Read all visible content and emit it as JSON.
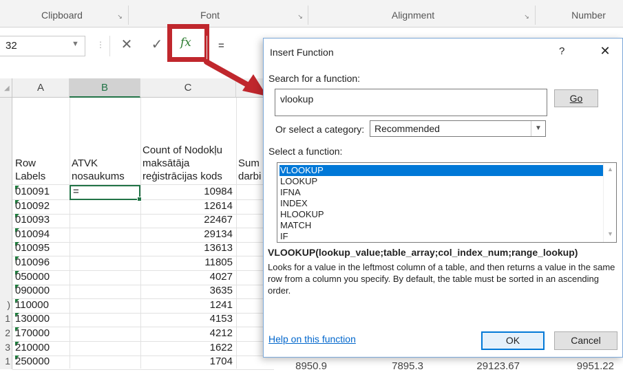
{
  "ribbon": {
    "groups": [
      {
        "label": "Clipboard"
      },
      {
        "label": "Font"
      },
      {
        "label": "Alignment"
      },
      {
        "label": "Number"
      }
    ],
    "launcher_icon": "dialog-launcher-icon"
  },
  "formula_bar": {
    "name_box": "32",
    "cancel_symbol": "✕",
    "enter_symbol": "✓",
    "fx_label": "fx",
    "formula": "="
  },
  "sheet": {
    "columns": [
      "A",
      "B",
      "C"
    ],
    "selected_column": "B",
    "header_row": {
      "a": "Row\nLabels",
      "b": "ATVK\nnosaukums",
      "c": "Count of Nodokļu\nmaksātāja\nreģistrācijas kods",
      "d": "Sum\ndarbi"
    },
    "rows": [
      {
        "num": "",
        "a": "010091",
        "b": "=",
        "c": "10984"
      },
      {
        "num": "",
        "a": "010092",
        "b": "",
        "c": "12614"
      },
      {
        "num": "",
        "a": "010093",
        "b": "",
        "c": "22467"
      },
      {
        "num": "",
        "a": "010094",
        "b": "",
        "c": "29134"
      },
      {
        "num": "",
        "a": "010095",
        "b": "",
        "c": "13613"
      },
      {
        "num": "",
        "a": "010096",
        "b": "",
        "c": "11805"
      },
      {
        "num": "",
        "a": "050000",
        "b": "",
        "c": "4027"
      },
      {
        "num": "",
        "a": "090000",
        "b": "",
        "c": "3635"
      },
      {
        "num": ")",
        "a": "110000",
        "b": "",
        "c": "1241"
      },
      {
        "num": "1",
        "a": "130000",
        "b": "",
        "c": "4153"
      },
      {
        "num": "2",
        "a": "170000",
        "b": "",
        "c": "4212"
      },
      {
        "num": "3",
        "a": "210000",
        "b": "",
        "c": "1622"
      },
      {
        "num": "1",
        "a": "250000",
        "b": "",
        "c": "1704"
      }
    ],
    "bottom_values": [
      "8950.9",
      "7895.3",
      "29123.67",
      "9951.22"
    ]
  },
  "dialog": {
    "title": "Insert Function",
    "help": "?",
    "close": "✕",
    "search_label": "Search for a function:",
    "search_value": "vlookup",
    "go_label": "Go",
    "category_label": "Or select a category:",
    "category_value": "Recommended",
    "select_label": "Select a function:",
    "functions": [
      "VLOOKUP",
      "LOOKUP",
      "IFNA",
      "INDEX",
      "HLOOKUP",
      "MATCH",
      "IF"
    ],
    "selected_function": "VLOOKUP",
    "signature": "VLOOKUP(lookup_value;table_array;col_index_num;range_lookup)",
    "description": "Looks for a value in the leftmost column of a table, and then returns a value in the same row from a column you specify. By default, the table must be sorted in an ascending order.",
    "help_link": "Help on this function",
    "ok_label": "OK",
    "cancel_label": "Cancel"
  },
  "colors": {
    "highlight_box": "#c0272d",
    "excel_green": "#217346",
    "selection_blue": "#0078d7"
  }
}
